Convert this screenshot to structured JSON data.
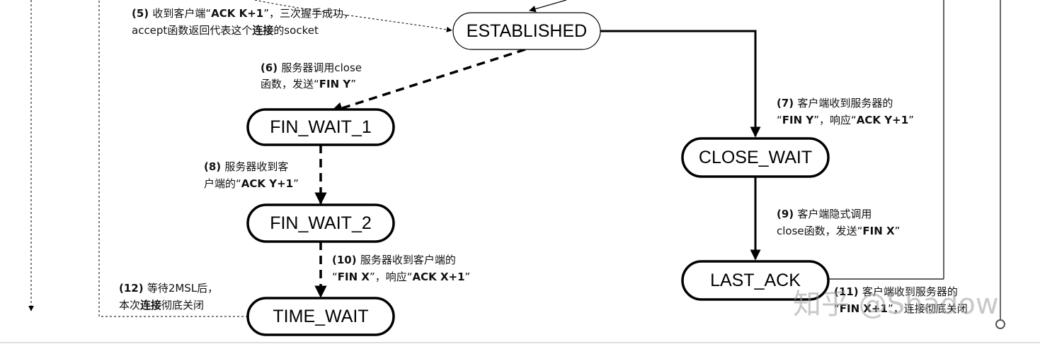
{
  "states": {
    "established": "ESTABLISHED",
    "fin_wait_1": "FIN_WAIT_1",
    "fin_wait_2": "FIN_WAIT_2",
    "time_wait": "TIME_WAIT",
    "close_wait": "CLOSE_WAIT",
    "last_ack": "LAST_ACK"
  },
  "notes": {
    "n5": {
      "l1": [
        {
          "t": "(5) ",
          "b": true
        },
        {
          "t": "收到客户端“",
          "b": false
        },
        {
          "t": "ACK K+1",
          "b": true
        },
        {
          "t": "”，三次握手成功，",
          "b": false
        }
      ],
      "l2": [
        {
          "t": "accept函数返回代表这个",
          "b": false
        },
        {
          "t": "连接",
          "b": true
        },
        {
          "t": "的socket",
          "b": false
        }
      ]
    },
    "n6": {
      "l1": [
        {
          "t": "(6) ",
          "b": true
        },
        {
          "t": "服务器调用close",
          "b": false
        }
      ],
      "l2": [
        {
          "t": "函数，发送“",
          "b": false
        },
        {
          "t": "FIN Y",
          "b": true
        },
        {
          "t": "”",
          "b": false
        }
      ]
    },
    "n7": {
      "l1": [
        {
          "t": "(7) ",
          "b": true
        },
        {
          "t": "客户端收到服务器的",
          "b": false
        }
      ],
      "l2": [
        {
          "t": "“",
          "b": false
        },
        {
          "t": "FIN Y",
          "b": true
        },
        {
          "t": "”，响应“",
          "b": false
        },
        {
          "t": "ACK Y+1",
          "b": true
        },
        {
          "t": "”",
          "b": false
        }
      ]
    },
    "n8": {
      "l1": [
        {
          "t": "(8) ",
          "b": true
        },
        {
          "t": "服务器收到客",
          "b": false
        }
      ],
      "l2": [
        {
          "t": "户端的“",
          "b": false
        },
        {
          "t": "ACK Y+1",
          "b": true
        },
        {
          "t": "”",
          "b": false
        }
      ]
    },
    "n9": {
      "l1": [
        {
          "t": "(9) ",
          "b": true
        },
        {
          "t": "客户端隐式调用",
          "b": false
        }
      ],
      "l2": [
        {
          "t": "close函数，发送“",
          "b": false
        },
        {
          "t": "FIN X",
          "b": true
        },
        {
          "t": "”",
          "b": false
        }
      ]
    },
    "n10": {
      "l1": [
        {
          "t": "(10) ",
          "b": true
        },
        {
          "t": "服务器收到客户端的",
          "b": false
        }
      ],
      "l2": [
        {
          "t": "“",
          "b": false
        },
        {
          "t": "FIN X",
          "b": true
        },
        {
          "t": "”，响应“",
          "b": false
        },
        {
          "t": "ACK X+1",
          "b": true
        },
        {
          "t": "”",
          "b": false
        }
      ]
    },
    "n11": {
      "l1": [
        {
          "t": "(11) ",
          "b": true
        },
        {
          "t": "客户端收到服务器的",
          "b": false
        }
      ],
      "l2": [
        {
          "t": "“",
          "b": false
        },
        {
          "t": "FIN X+1",
          "b": true
        },
        {
          "t": "”，连接彻底关闭",
          "b": false
        }
      ]
    },
    "n12": {
      "l1": [
        {
          "t": "(12) ",
          "b": true
        },
        {
          "t": "等待2MSL后，",
          "b": false
        }
      ],
      "l2": [
        {
          "t": "本次",
          "b": false
        },
        {
          "t": "连接",
          "b": true
        },
        {
          "t": "彻底关闭",
          "b": false
        }
      ]
    }
  },
  "watermark": "知乎 @Shadow"
}
